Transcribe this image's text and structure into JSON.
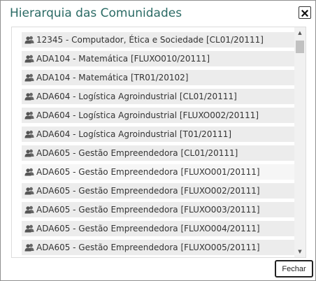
{
  "dialog": {
    "title": "Hierarquia das Comunidades",
    "close_icon": "close-icon"
  },
  "list": {
    "item_icon": "users-icon",
    "items": [
      {
        "label": "12345 - Computador, Ética e Sociedade [CL01/20111]"
      },
      {
        "label": "ADA104 - Matemática [FLUXO010/20111]"
      },
      {
        "label": "ADA104 - Matemática [TR01/20102]"
      },
      {
        "label": "ADA604 - Logística Agroindustrial [CL01/20111]"
      },
      {
        "label": "ADA604 - Logística Agroindustrial [FLUXO002/20111]"
      },
      {
        "label": "ADA604 - Logística Agroindustrial [T01/20111]"
      },
      {
        "label": "ADA605 - Gestão Empreendedora [CL01/20111]"
      },
      {
        "label": "ADA605 - Gestão Empreendedora [FLUXO001/20111]"
      },
      {
        "label": "ADA605 - Gestão Empreendedora [FLUXO002/20111]"
      },
      {
        "label": "ADA605 - Gestão Empreendedora [FLUXO003/20111]"
      },
      {
        "label": "ADA605 - Gestão Empreendedora [FLUXO004/20111]"
      },
      {
        "label": "ADA605 - Gestão Empreendedora [FLUXO005/20111]"
      }
    ]
  },
  "footer": {
    "close_label": "Fechar"
  },
  "colors": {
    "title": "#2a6a64",
    "item_background": "#ececec",
    "item_text": "#333333"
  }
}
